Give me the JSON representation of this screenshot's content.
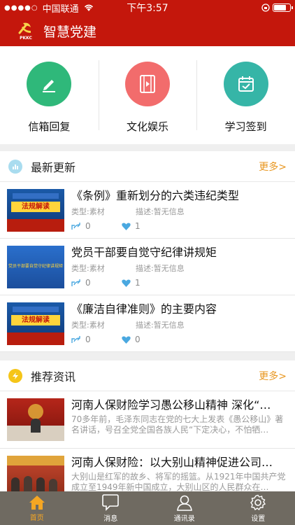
{
  "status": {
    "carrier": "中国联通",
    "time": "下午3:57",
    "battery_level": 0.7
  },
  "app": {
    "title": "智慧党建",
    "logo_text": "PKKC"
  },
  "quick_actions": [
    {
      "label": "信箱回复",
      "color": "#2fb87a",
      "icon": "pen-icon"
    },
    {
      "label": "文化娱乐",
      "color": "#f26c6c",
      "icon": "film-icon"
    },
    {
      "label": "学习签到",
      "color": "#36b5a7",
      "icon": "calendar-check-icon"
    }
  ],
  "latest": {
    "title": "最新更新",
    "more": "更多>",
    "items": [
      {
        "title": "《条例》重新划分的六类违纪类型",
        "type": "类型:素材",
        "desc": "描述:暂无信息",
        "shares": "0",
        "likes": "1",
        "thumb_text": "法规解读"
      },
      {
        "title": "党员干部要自觉守纪律讲规矩",
        "type": "类型:素材",
        "desc": "描述:暂无信息",
        "shares": "0",
        "likes": "1",
        "thumb_text": "党员干部要自觉守纪律讲规矩"
      },
      {
        "title": "《廉洁自律准则》的主要内容",
        "type": "类型:素材",
        "desc": "描述:暂无信息",
        "shares": "0",
        "likes": "0",
        "thumb_text": "法规解读"
      }
    ]
  },
  "recommended": {
    "title": "推荐资讯",
    "more": "更多>",
    "items": [
      {
        "title": "河南人保财险学习愚公移山精神 深化“…",
        "desc": "70多年前，毛泽东同志在党的七大上发表《愚公移山》著名讲话，号召全党全国各族人民“下定决心，不怕牺…"
      },
      {
        "title": "河南人保财险：以大别山精神促进公司…",
        "desc": "大别山是红军的故乡、将军的摇篮。从1921年中国共产党成立至1949年新中国成立，大别山区的人民群众在…"
      }
    ]
  },
  "tabs": [
    {
      "label": "首页",
      "active": true
    },
    {
      "label": "消息",
      "active": false
    },
    {
      "label": "通讯录",
      "active": false
    },
    {
      "label": "设置",
      "active": false
    }
  ]
}
